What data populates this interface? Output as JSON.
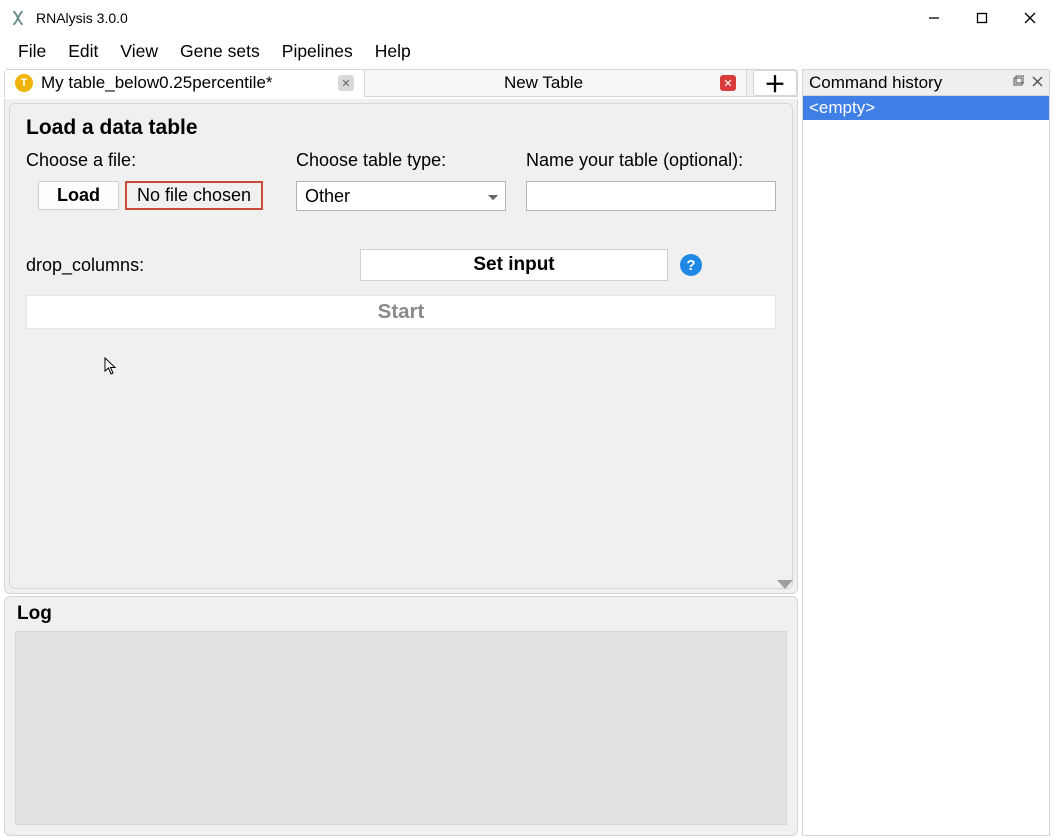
{
  "window": {
    "title": "RNAlysis 3.0.0"
  },
  "menu": {
    "file": "File",
    "edit": "Edit",
    "view": "View",
    "gene_sets": "Gene sets",
    "pipelines": "Pipelines",
    "help": "Help"
  },
  "tabs": {
    "active": {
      "badge": "T",
      "label": "My table_below0.25percentile*"
    },
    "other": {
      "label": "New Table"
    }
  },
  "panel": {
    "group_title": "Load a data table",
    "choose_file_label": "Choose a file:",
    "load_btn": "Load",
    "file_status": "No file chosen",
    "choose_type_label": "Choose table type:",
    "type_selected": "Other",
    "name_label": "Name your table (optional):",
    "name_value": "",
    "drop_columns_label": "drop_columns:",
    "set_input_btn": "Set input",
    "help": "?",
    "start_btn": "Start"
  },
  "log": {
    "title": "Log"
  },
  "history": {
    "title": "Command history",
    "item": "<empty>"
  }
}
